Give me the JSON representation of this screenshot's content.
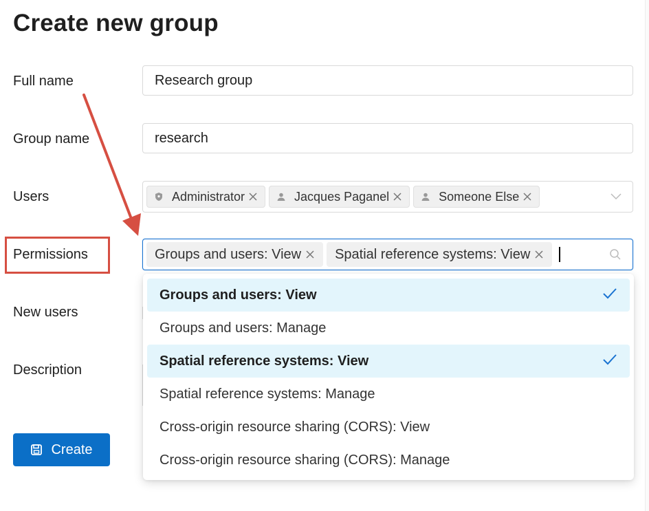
{
  "page": {
    "title": "Create new group"
  },
  "form": {
    "full_name": {
      "label": "Full name",
      "value": "Research group"
    },
    "group_name": {
      "label": "Group name",
      "value": "research"
    },
    "users": {
      "label": "Users",
      "selected": [
        {
          "name": "Administrator",
          "icon": "shield-icon"
        },
        {
          "name": "Jacques Paganel",
          "icon": "user-icon"
        },
        {
          "name": "Someone Else",
          "icon": "user-icon"
        }
      ]
    },
    "permissions": {
      "label": "Permissions",
      "selected": [
        "Groups and users: View",
        "Spatial reference systems: View"
      ]
    },
    "new_users": {
      "label": "New users"
    },
    "description": {
      "label": "Description"
    }
  },
  "dropdown": {
    "options": [
      {
        "label": "Groups and users: View",
        "selected": true
      },
      {
        "label": "Groups and users: Manage",
        "selected": false
      },
      {
        "label": "Spatial reference systems: View",
        "selected": true
      },
      {
        "label": "Spatial reference systems: Manage",
        "selected": false
      },
      {
        "label": "Cross-origin resource sharing (CORS): View",
        "selected": false
      },
      {
        "label": "Cross-origin resource sharing (CORS): Manage",
        "selected": false
      }
    ]
  },
  "actions": {
    "create_label": "Create",
    "create_icon": "save-icon"
  },
  "colors": {
    "primary": "#0b6fc7",
    "focus_border": "#1a73d1",
    "selected_option_bg": "#e3f5fc",
    "annotation": "#d64f42"
  }
}
